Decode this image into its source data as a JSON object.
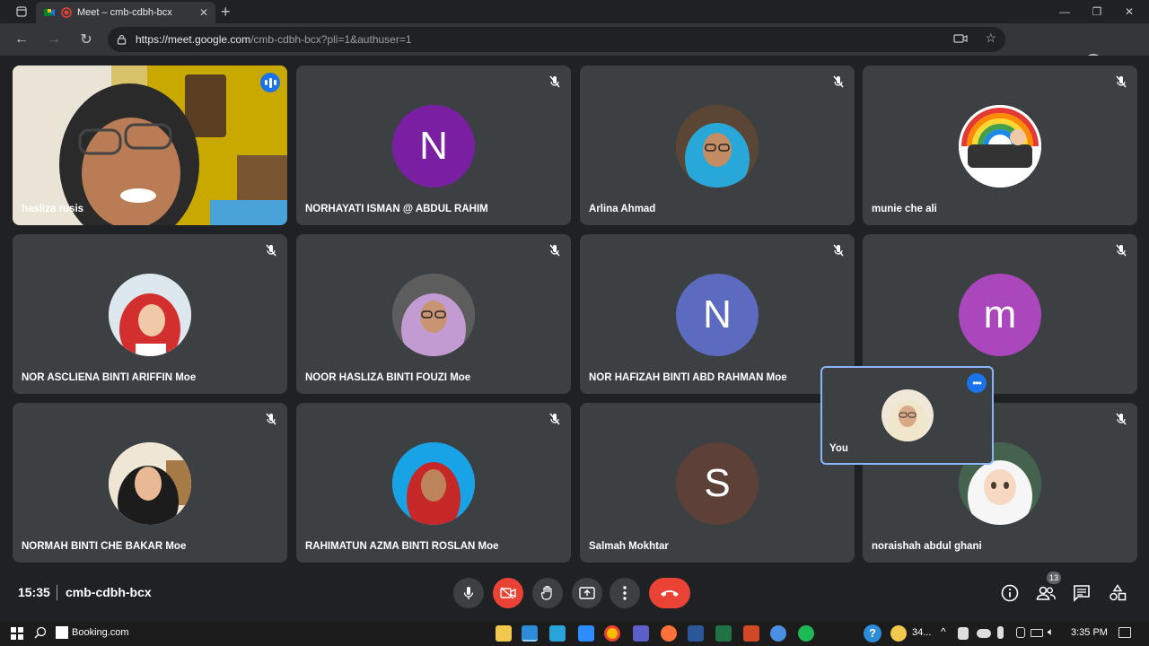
{
  "browser": {
    "tab_title": "Meet – cmb-cdbh-bcx",
    "url_host": "https://meet.google.com",
    "url_path": "/cmb-cdbh-bcx?pli=1&authuser=1"
  },
  "tiles": [
    {
      "name": "hasliza rusis",
      "type": "video",
      "speaking": true
    },
    {
      "name": "NORHAYATI ISMAN @ ABDUL RAHIM",
      "type": "letter",
      "letter": "N",
      "color": "#7b1fa2"
    },
    {
      "name": "Arlina Ahmad",
      "type": "photo"
    },
    {
      "name": "munie che ali",
      "type": "photo"
    },
    {
      "name": "NOR ASCLIENA BINTI ARIFFIN Moe",
      "type": "photo"
    },
    {
      "name": "NOOR HASLIZA BINTI FOUZI Moe",
      "type": "photo"
    },
    {
      "name": "NOR HAFIZAH BINTI ABD RAHMAN Moe",
      "type": "letter",
      "letter": "N",
      "color": "#5c6bc0"
    },
    {
      "name": "",
      "type": "letter",
      "letter": "m",
      "color": "#ab47bc"
    },
    {
      "name": "NORMAH BINTI CHE BAKAR Moe",
      "type": "photo"
    },
    {
      "name": "RAHIMATUN AZMA BINTI ROSLAN Moe",
      "type": "photo"
    },
    {
      "name": "Salmah Mokhtar",
      "type": "letter",
      "letter": "S",
      "color": "#5d4037"
    },
    {
      "name": "noraishah abdul ghani",
      "type": "photo"
    }
  ],
  "self_tile": {
    "name": "You"
  },
  "controls": {
    "time": "15:35",
    "meeting_code": "cmb-cdbh-bcx",
    "participant_count": "13"
  },
  "taskbar": {
    "search_text": "Booking.com",
    "weather": "34...",
    "clock": "3:35 PM"
  },
  "colors": {
    "accent": "#1a73e8",
    "danger": "#ea4335",
    "tile_bg": "#3c4043"
  }
}
